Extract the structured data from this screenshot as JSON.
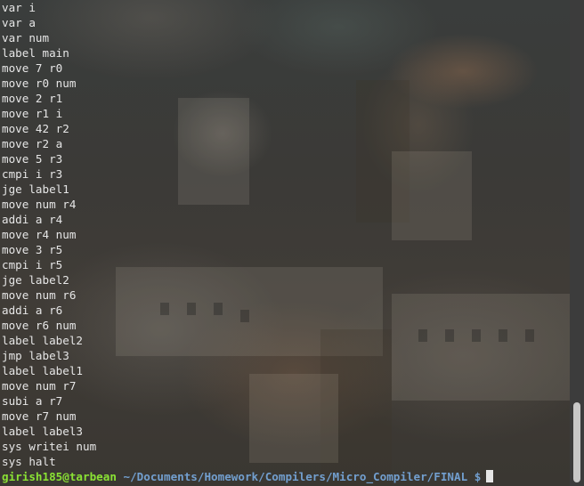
{
  "terminal": {
    "lines": [
      "var i",
      "var a",
      "var num",
      "label main",
      "move 7 r0",
      "move r0 num",
      "move 2 r1",
      "move r1 i",
      "move 42 r2",
      "move r2 a",
      "move 5 r3",
      "cmpi i r3",
      "jge label1",
      "move num r4",
      "addi a r4",
      "move r4 num",
      "move 3 r5",
      "cmpi i r5",
      "jge label2",
      "move num r6",
      "addi a r6",
      "move r6 num",
      "label label2",
      "jmp label3",
      "label label1",
      "move num r7",
      "subi a r7",
      "move r7 num",
      "label label3",
      "sys writei num",
      "sys halt"
    ],
    "prompt": {
      "user_host": "girish185@tarbean",
      "path": " ~/Documents/Homework/Compilers/Micro_Compiler/FINAL",
      "symbol": " $"
    }
  },
  "colors": {
    "text": "#e6e6e6",
    "prompt_user": "#8ae234",
    "prompt_path": "#729fcf"
  }
}
